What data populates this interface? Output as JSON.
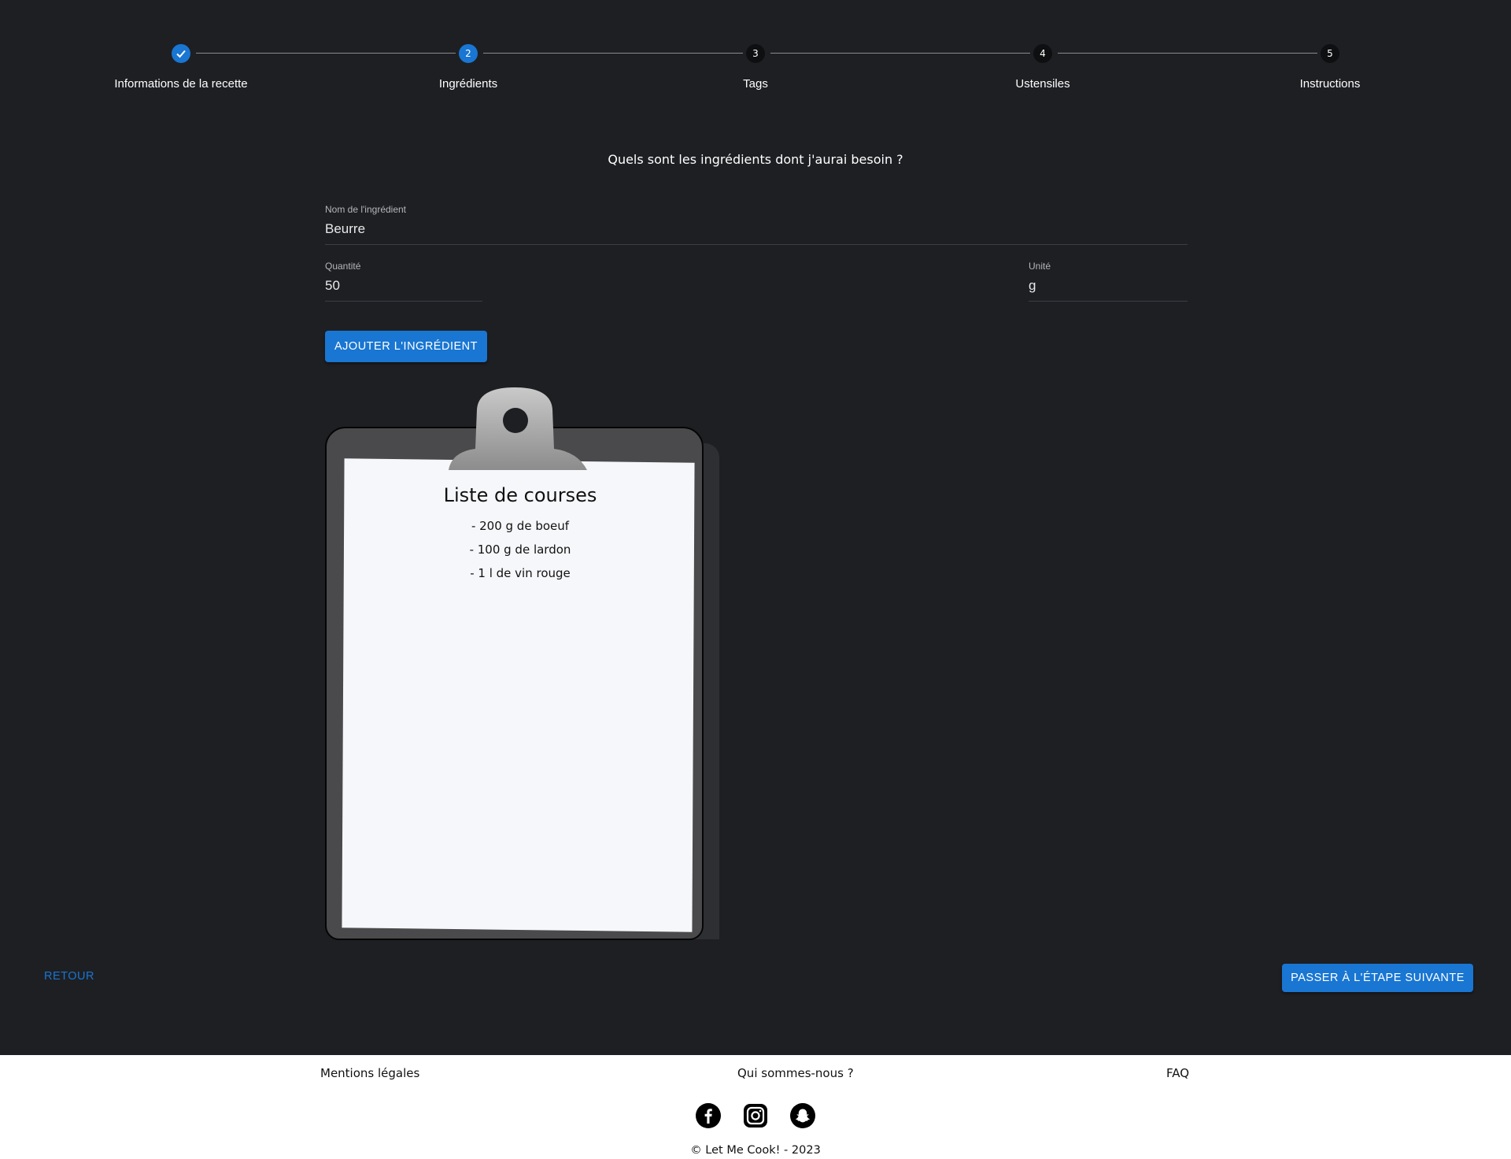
{
  "stepper": {
    "steps": [
      {
        "number": "1",
        "label": "Informations de la recette",
        "state": "completed"
      },
      {
        "number": "2",
        "label": "Ingrédients",
        "state": "active"
      },
      {
        "number": "3",
        "label": "Tags",
        "state": "pending"
      },
      {
        "number": "4",
        "label": "Ustensiles",
        "state": "pending"
      },
      {
        "number": "5",
        "label": "Instructions",
        "state": "pending"
      }
    ]
  },
  "form": {
    "question": "Quels sont les ingrédients dont j'aurai besoin ?",
    "ingredient_name": {
      "label": "Nom de l'ingrédient",
      "value": "Beurre"
    },
    "quantity": {
      "label": "Quantité",
      "value": "50"
    },
    "unit": {
      "label": "Unité",
      "value": "g"
    },
    "add_button": "AJOUTER L'INGRÉDIENT"
  },
  "shopping_list": {
    "title": "Liste de courses",
    "items": [
      "- 200 g de boeuf",
      "- 100 g de lardon",
      "- 1 l de vin rouge"
    ]
  },
  "navigation": {
    "back_label": "RETOUR",
    "next_label": "PASSER À L'ÉTAPE SUIVANTE"
  },
  "footer": {
    "links": [
      "Mentions légales",
      "Qui sommes-nous ?",
      "FAQ"
    ],
    "social_icons": [
      "facebook-icon",
      "instagram-icon",
      "snapchat-icon"
    ],
    "copyright": "© Let Me Cook! - 2023"
  },
  "colors": {
    "background": "#1e1f23",
    "accent": "#1976d2",
    "footer_background": "#ffffff"
  }
}
